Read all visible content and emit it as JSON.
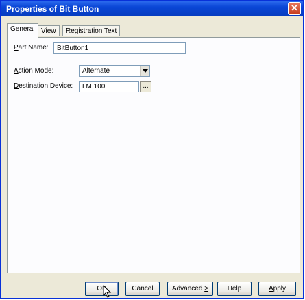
{
  "window": {
    "title": "Properties of Bit Button"
  },
  "tabs": [
    {
      "label": "General",
      "active": true
    },
    {
      "label": "View",
      "active": false
    },
    {
      "label": "Registration Text",
      "active": false
    }
  ],
  "fields": {
    "part_name": {
      "label_first": "P",
      "label_rest": "art Name:",
      "value": "BitButton1"
    },
    "action_mode": {
      "label_first": "A",
      "label_rest": "ction Mode:",
      "value": "Alternate"
    },
    "destination_device": {
      "label_first": "D",
      "label_rest": "estination Device:",
      "value": "LM 100",
      "browse_label": "..."
    }
  },
  "buttons": {
    "ok": "OK",
    "cancel": "Cancel",
    "advanced": "Advanced",
    "advanced_suffix": ">",
    "help": "Help",
    "apply_first": "A",
    "apply_rest": "pply"
  },
  "icons": {
    "close": "close-icon",
    "dropdown": "chevron-down-icon",
    "cursor": "mouse-pointer-icon"
  }
}
